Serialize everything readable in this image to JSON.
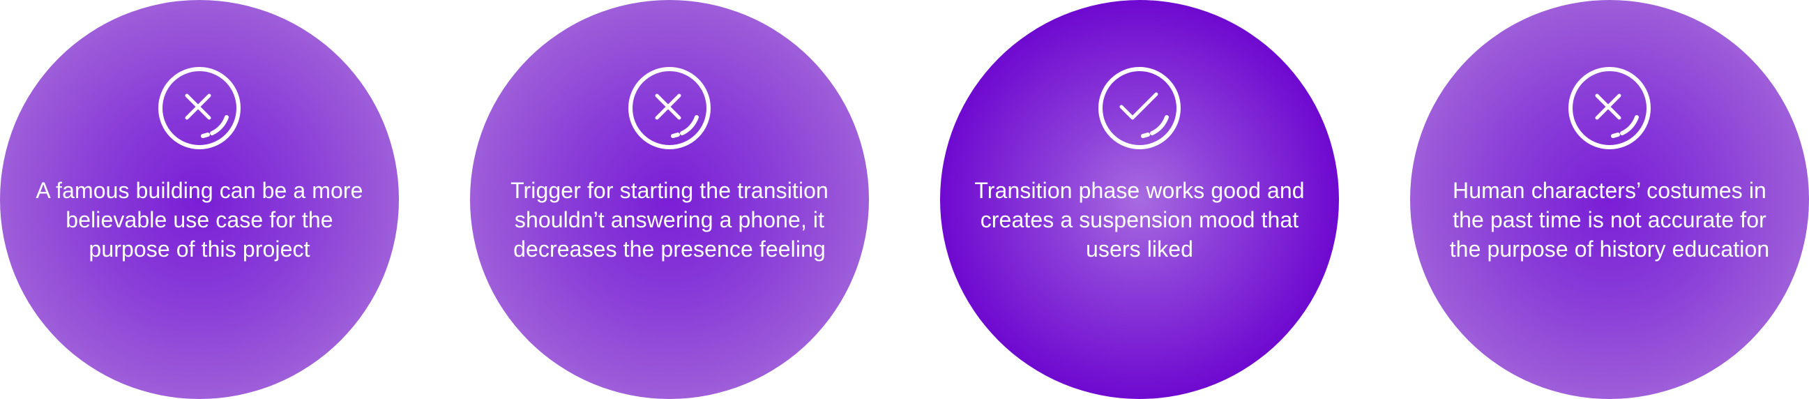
{
  "cards": [
    {
      "status": "negative",
      "icon": "x-circle-icon",
      "text": "A famous building can be a more believable use case for the purpose of this project"
    },
    {
      "status": "negative",
      "icon": "x-circle-icon",
      "text": "Trigger for starting the transition shouldn’t answering a phone, it decreases the presence feeling"
    },
    {
      "status": "positive",
      "icon": "check-circle-icon",
      "text": "Transition phase works good and creates a suspension mood that users liked"
    },
    {
      "status": "negative",
      "icon": "x-circle-icon",
      "text": "Human characters’ costumes in the past time is not accurate for the purpose of history education"
    }
  ],
  "colors": {
    "negative_card": "#a467d9",
    "positive_card": "#6a00cc",
    "text": "#ffffff"
  }
}
